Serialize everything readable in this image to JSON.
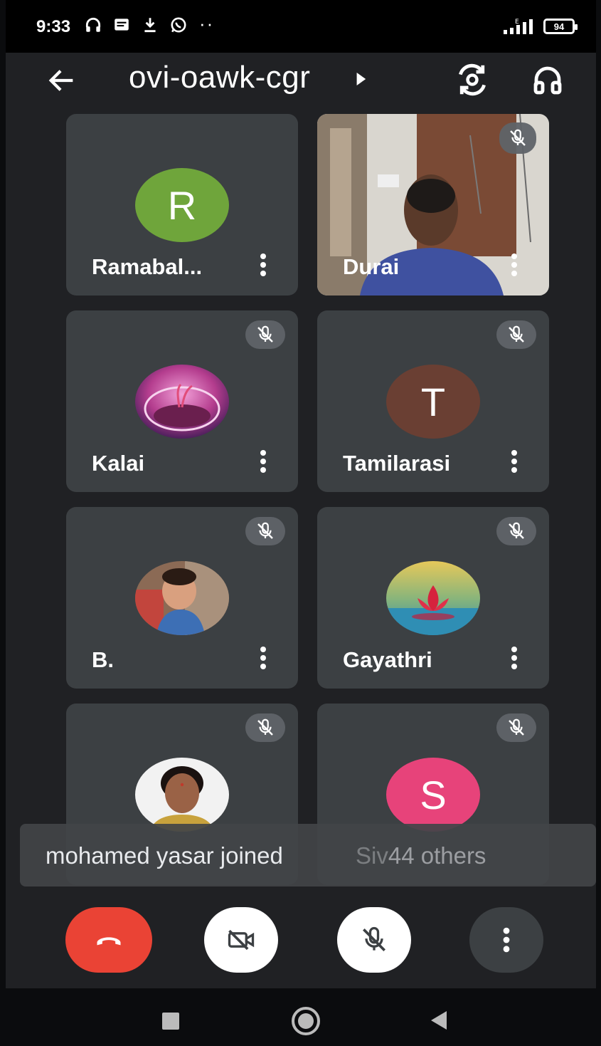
{
  "status_bar": {
    "time": "9:33",
    "network": "E",
    "battery": "94"
  },
  "header": {
    "meeting_code": "ovi-oawk-cgr"
  },
  "participants": [
    {
      "name": "Ramabal...",
      "avatar": "R",
      "avatar_color": "#6fa53b",
      "muted": false
    },
    {
      "name": "Durai",
      "avatar": "video",
      "muted": true
    },
    {
      "name": "Kalai",
      "avatar": "photo-flower-bowl",
      "muted": true
    },
    {
      "name": "Tamilarasi",
      "avatar": "T",
      "avatar_color": "#6a3f33",
      "muted": true
    },
    {
      "name": "B.",
      "avatar": "photo-child",
      "muted": true
    },
    {
      "name": "Gayathri",
      "avatar": "photo-lotus",
      "muted": true
    },
    {
      "name": "",
      "avatar": "photo-woman",
      "muted": true
    },
    {
      "name": "",
      "avatar": "S",
      "avatar_color": "#e7437a",
      "muted": true
    }
  ],
  "toast": {
    "message": "mohamed yasar joined",
    "overflow_partial": "Siv",
    "overflow_label": "44 others"
  },
  "controls": {
    "end_call_icon": "phone-hangup-icon",
    "camera_icon": "camera-off-icon",
    "mic_icon": "mic-off-icon",
    "more_icon": "more-vert-icon",
    "end_call_color": "#ea4335"
  },
  "colors": {
    "background": "#202124",
    "tile": "#3c4043",
    "mute_badge": "#5f6368"
  }
}
